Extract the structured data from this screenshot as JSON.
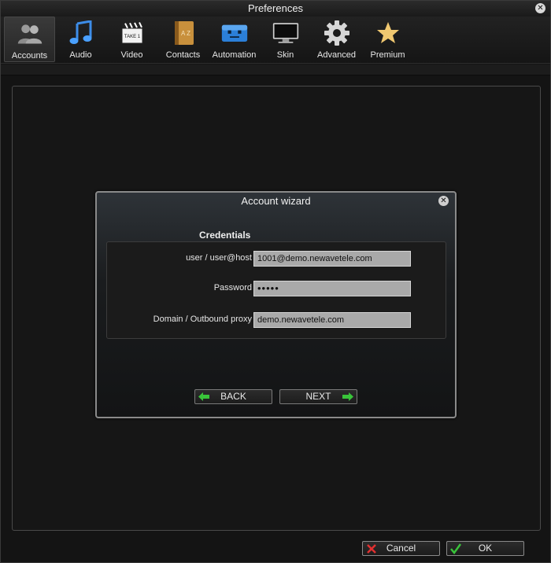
{
  "window": {
    "title": "Preferences"
  },
  "toolbar": {
    "items": [
      {
        "label": "Accounts",
        "icon": "accounts-icon",
        "active": true
      },
      {
        "label": "Audio",
        "icon": "music-note-icon"
      },
      {
        "label": "Video",
        "icon": "clapperboard-icon"
      },
      {
        "label": "Contacts",
        "icon": "address-book-icon"
      },
      {
        "label": "Automation",
        "icon": "robot-icon"
      },
      {
        "label": "Skin",
        "icon": "monitor-icon"
      },
      {
        "label": "Advanced",
        "icon": "gear-icon"
      },
      {
        "label": "Premium",
        "icon": "star-icon"
      }
    ]
  },
  "clapper_text": "TAKE 1",
  "contacts_letters": "A Z",
  "dialog": {
    "title": "Account wizard",
    "section_title": "Credentials",
    "fields": {
      "user": {
        "label": "user / user@host",
        "value": "1001@demo.newavetele.com"
      },
      "password": {
        "label": "Password",
        "value": "•••••"
      },
      "domain": {
        "label": "Domain / Outbound proxy",
        "value": "demo.newavetele.com"
      }
    },
    "back_label": "BACK",
    "next_label": "NEXT"
  },
  "footer": {
    "cancel_label": "Cancel",
    "ok_label": "OK"
  },
  "colors": {
    "accent_green": "#39c43a",
    "cancel_red": "#e03030",
    "field_bg": "#a9a9a9"
  }
}
